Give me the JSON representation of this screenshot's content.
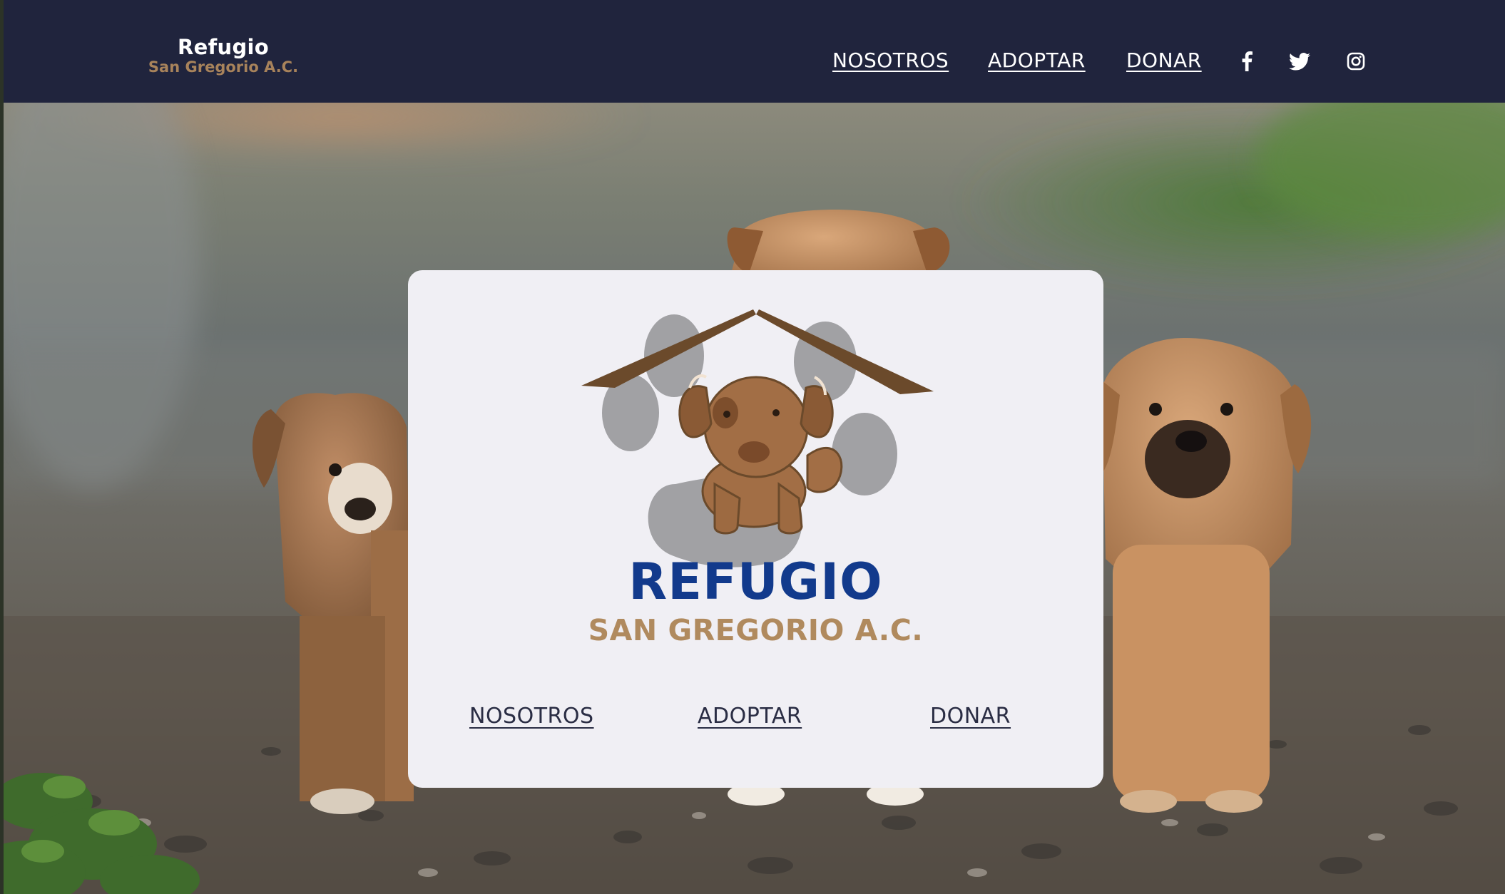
{
  "header": {
    "brand_title": "Refugio",
    "brand_subtitle": "San Gregorio A.C.",
    "nav": [
      {
        "label": "NOSOTROS"
      },
      {
        "label": "ADOPTAR"
      },
      {
        "label": "DONAR"
      }
    ],
    "social": [
      "facebook-icon",
      "twitter-icon",
      "instagram-icon"
    ]
  },
  "hero": {
    "image": "three puppies peeking from behind the card on a gravel path"
  },
  "card": {
    "logo_title": "REFUGIO",
    "logo_subtitle": "SAN GREGORIO A.C.",
    "links": [
      {
        "label": "NOSOTROS"
      },
      {
        "label": "ADOPTAR"
      },
      {
        "label": "DONAR"
      }
    ]
  },
  "colors": {
    "header_bg": "#20243d",
    "brand_accent": "#a8835b",
    "logo_blue": "#123a8c",
    "card_bg": "#f0eff4"
  }
}
